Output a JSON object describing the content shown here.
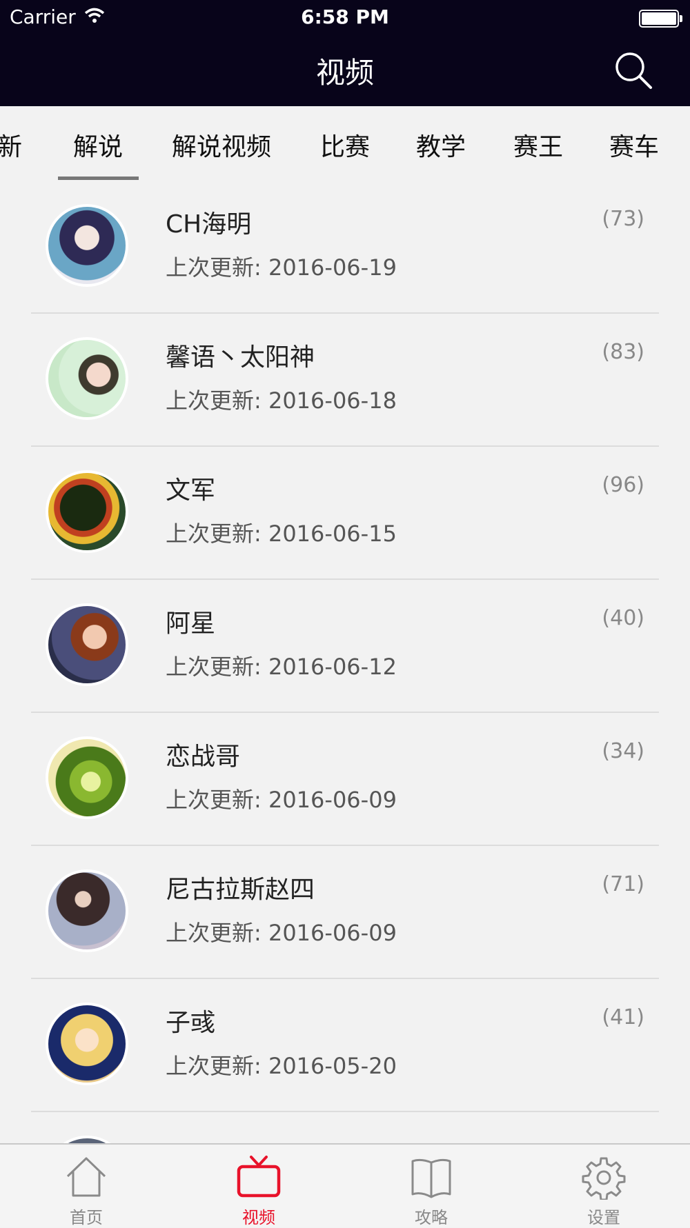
{
  "status_bar": {
    "carrier": "Carrier",
    "time": "6:58 PM"
  },
  "nav": {
    "title": "视频"
  },
  "tabs": [
    {
      "label": "新"
    },
    {
      "label": "解说",
      "selected": true
    },
    {
      "label": "解说视频"
    },
    {
      "label": "比赛"
    },
    {
      "label": "教学"
    },
    {
      "label": "赛王"
    },
    {
      "label": "赛车"
    }
  ],
  "list": [
    {
      "name": "CH海明",
      "updated": "上次更新: 2016-06-19",
      "count": "(73)"
    },
    {
      "name": "馨语丶太阳神",
      "updated": "上次更新: 2016-06-18",
      "count": "(83)"
    },
    {
      "name": "文军",
      "updated": "上次更新: 2016-06-15",
      "count": "(96)"
    },
    {
      "name": "阿星",
      "updated": "上次更新: 2016-06-12",
      "count": "(40)"
    },
    {
      "name": "恋战哥",
      "updated": "上次更新: 2016-06-09",
      "count": "(34)"
    },
    {
      "name": "尼古拉斯赵四",
      "updated": "上次更新: 2016-06-09",
      "count": "(71)"
    },
    {
      "name": "子彧",
      "updated": "上次更新: 2016-05-20",
      "count": "(41)"
    },
    {
      "name": "",
      "updated": "",
      "count": ""
    }
  ],
  "tabbar": [
    {
      "label": "首页",
      "icon": "home-icon"
    },
    {
      "label": "视频",
      "icon": "tv-icon",
      "active": true
    },
    {
      "label": "攻略",
      "icon": "book-icon"
    },
    {
      "label": "设置",
      "icon": "gear-icon"
    }
  ],
  "colors": {
    "header_bg": "#08041a",
    "accent": "#e8122a",
    "page_bg": "#f2f2f2"
  }
}
